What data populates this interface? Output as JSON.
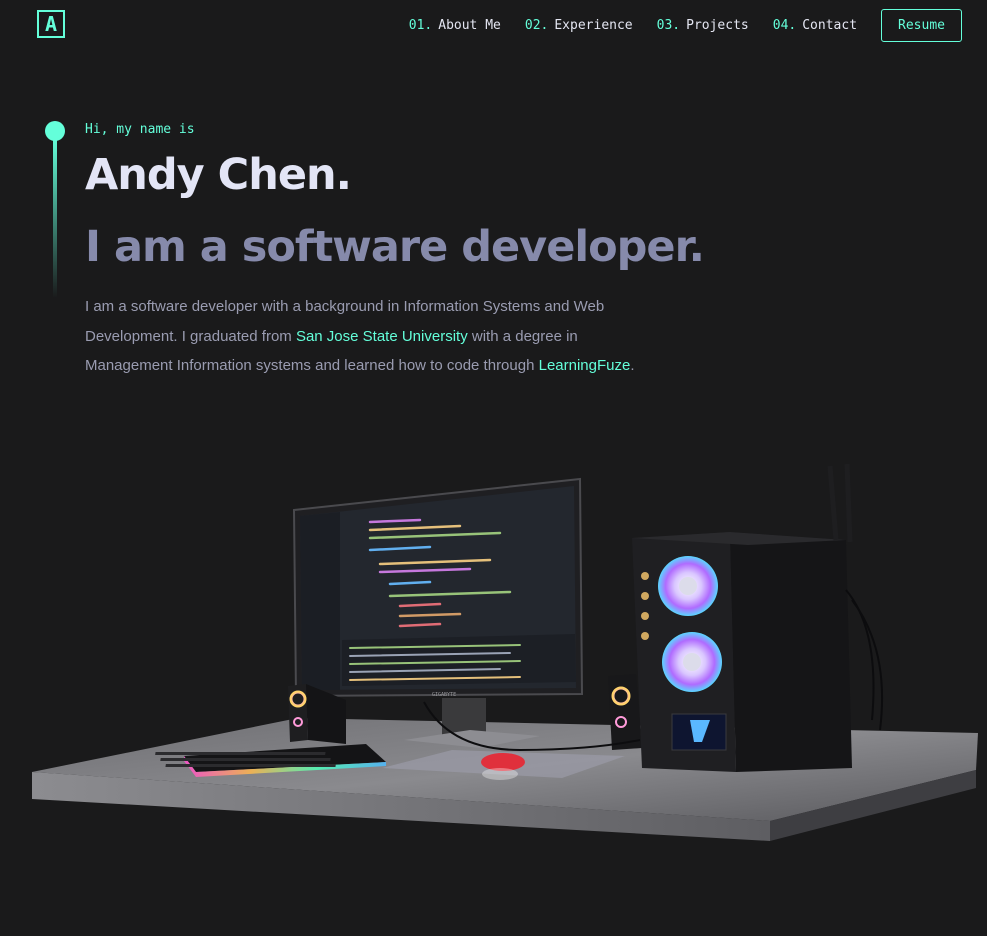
{
  "logo": {
    "letter": "A"
  },
  "nav": {
    "items": [
      {
        "num": "01.",
        "label": "About Me"
      },
      {
        "num": "02.",
        "label": "Experience"
      },
      {
        "num": "03.",
        "label": "Projects"
      },
      {
        "num": "04.",
        "label": "Contact"
      }
    ],
    "resume_label": "Resume"
  },
  "hero": {
    "greeting": "Hi, my name is",
    "name": "Andy Chen.",
    "tagline": "I am a software developer.",
    "bio": {
      "part1": "I am a software developer with a background in Information Systems and Web Development. I graduated from ",
      "link1": "San Jose State University",
      "part2": " with a degree in Management Information systems and learned how to code through ",
      "link2": "LearningFuze",
      "part3": "."
    }
  },
  "scene": {
    "monitor_brand": "GIGABYTE",
    "accent_color": "#64ffda",
    "background_color": "#1a1a1b"
  }
}
